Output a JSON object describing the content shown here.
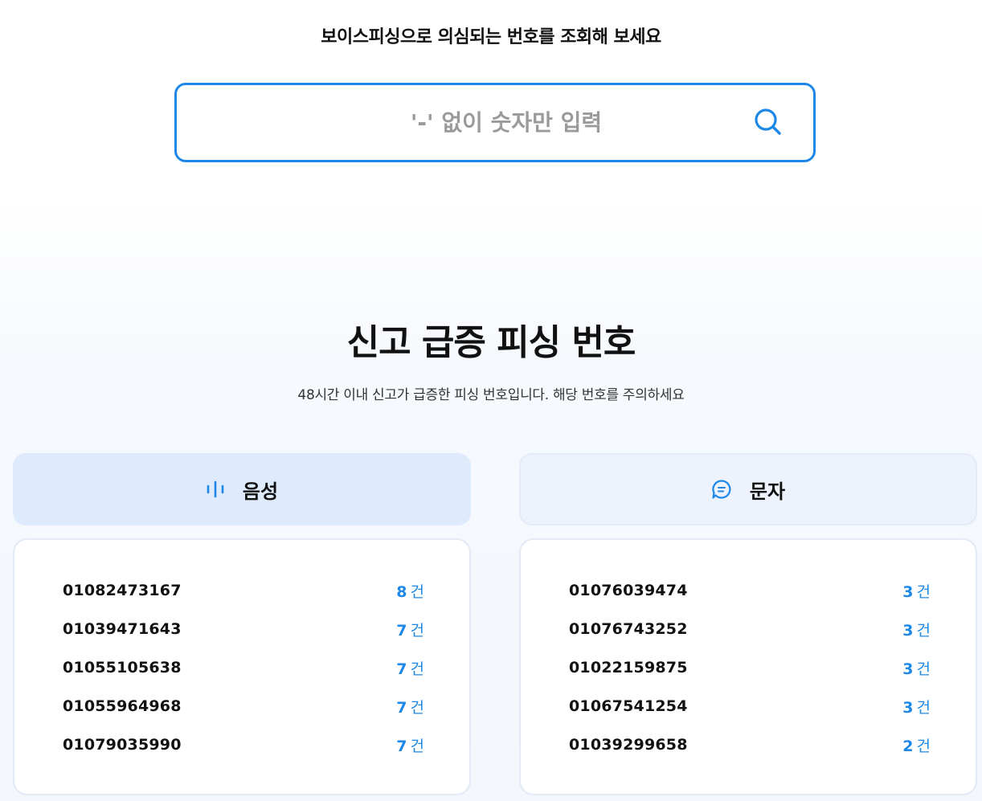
{
  "search": {
    "heading": "보이스피싱으로 의심되는 번호를 조회해 보세요",
    "placeholder": "'-' 없이 숫자만 입력",
    "value": ""
  },
  "section": {
    "title": "신고 급증 피싱 번호",
    "subtitle": "48시간 이내 신고가 급증한 피싱 번호입니다. 해당 번호를 주의하세요"
  },
  "tabs": {
    "voice": {
      "label": "음성",
      "icon": "waveform-icon"
    },
    "text": {
      "label": "문자",
      "icon": "chat-bubble-icon"
    }
  },
  "accent_color": "#1e88e8",
  "count_unit": "건",
  "voice_list": [
    {
      "number": "01082473167",
      "count": "8"
    },
    {
      "number": "01039471643",
      "count": "7"
    },
    {
      "number": "01055105638",
      "count": "7"
    },
    {
      "number": "01055964968",
      "count": "7"
    },
    {
      "number": "01079035990",
      "count": "7"
    }
  ],
  "text_list": [
    {
      "number": "01076039474",
      "count": "3"
    },
    {
      "number": "01076743252",
      "count": "3"
    },
    {
      "number": "01022159875",
      "count": "3"
    },
    {
      "number": "01067541254",
      "count": "3"
    },
    {
      "number": "01039299658",
      "count": "2"
    }
  ]
}
